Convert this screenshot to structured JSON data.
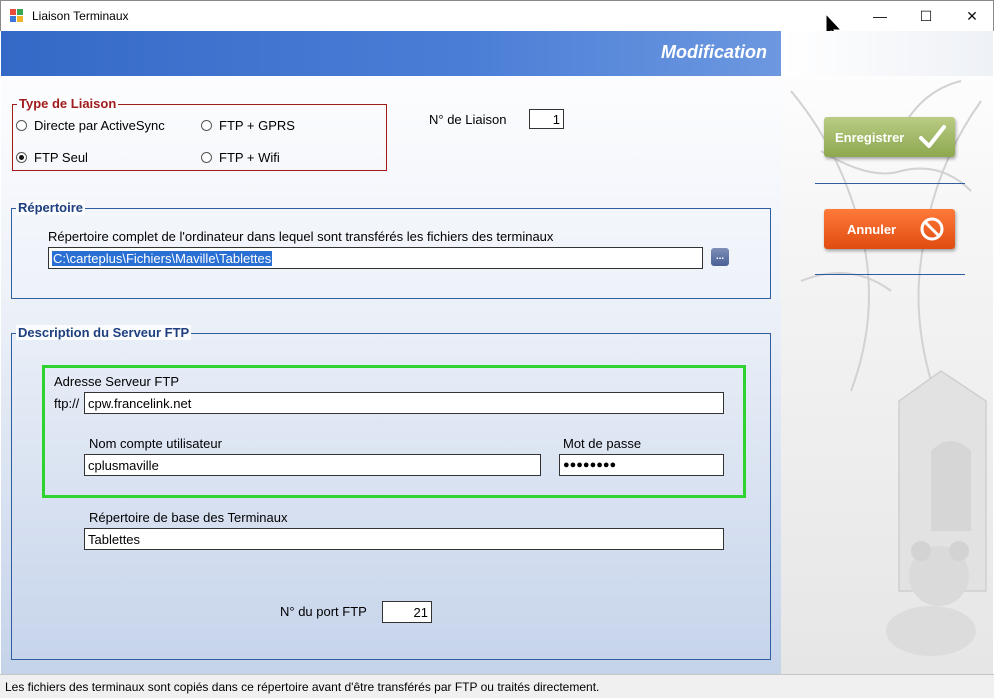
{
  "window": {
    "title": "Liaison Terminaux",
    "minimize_glyph": "—",
    "maximize_glyph": "☐",
    "close_glyph": "✕"
  },
  "header": {
    "title": "Modification"
  },
  "link_type": {
    "legend": "Type de Liaison",
    "options": [
      {
        "label": "Directe par ActiveSync",
        "selected": false
      },
      {
        "label": "FTP + GPRS",
        "selected": false
      },
      {
        "label": "FTP Seul",
        "selected": true
      },
      {
        "label": "FTP + Wifi",
        "selected": false
      }
    ]
  },
  "link_number": {
    "label": "N° de Liaison",
    "value": "1"
  },
  "directory": {
    "legend": "Répertoire",
    "description": "Répertoire complet de l'ordinateur dans lequel sont transférés les fichiers des terminaux",
    "path": "C:\\carteplus\\Fichiers\\Maville\\Tablettes",
    "browse_label": "..."
  },
  "ftp": {
    "legend": "Description du Serveur FTP",
    "server_label": "Adresse Serveur FTP",
    "prefix": "ftp://",
    "server": "cpw.francelink.net",
    "user_label": "Nom compte utilisateur",
    "user": "cplusmaville",
    "password_label": "Mot de passe",
    "password": "●●●●●●●●",
    "base_dir_label": "Répertoire de base des Terminaux",
    "base_dir": "Tablettes",
    "port_label": "N° du port  FTP",
    "port": "21"
  },
  "actions": {
    "save_label": "Enregistrer",
    "cancel_label": "Annuler"
  },
  "status": {
    "text": "Les fichiers des terminaux sont copiés dans ce répertoire avant d'être transférés par FTP ou traités directement."
  },
  "colors": {
    "header_blue": "#3569c7",
    "save_green": "#9db563",
    "cancel_orange": "#f2601f",
    "highlight_green": "#2fd32f",
    "group_red": "#a01c1c"
  }
}
